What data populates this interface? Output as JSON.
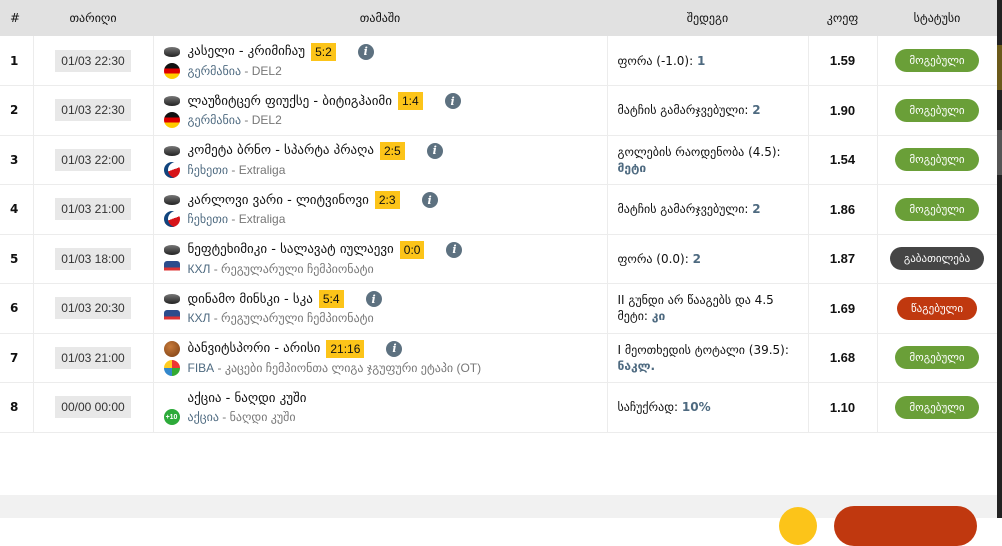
{
  "headers": {
    "num": "#",
    "date": "თარიღი",
    "game": "თამაში",
    "result": "შედეგი",
    "coef": "კოეფ",
    "status": "სტატუსი"
  },
  "rows": [
    {
      "num": "1",
      "date": "01/03 22:30",
      "sport": "hockey",
      "flag": "de",
      "match": "კასელი - კრიმიჩაუ",
      "score": "5:2",
      "country": "გერმანია",
      "league": "DEL2",
      "result_label": "ფორა (-1.0):",
      "result_value": "1",
      "coef": "1.59",
      "status": "მოგებული",
      "status_type": "won"
    },
    {
      "num": "2",
      "date": "01/03 22:30",
      "sport": "hockey",
      "flag": "de",
      "match": "ლაუზიტცერ ფიუქსე - ბიტიგჰაიმი",
      "score": "1:4",
      "country": "გერმანია",
      "league": "DEL2",
      "result_label": "მატჩის გამარჯვებული:",
      "result_value": "2",
      "coef": "1.90",
      "status": "მოგებული",
      "status_type": "won"
    },
    {
      "num": "3",
      "date": "01/03 22:00",
      "sport": "hockey",
      "flag": "cz",
      "match": "კომეტა ბრნო - სპარტა პრაღა",
      "score": "2:5",
      "country": "ჩეხეთი",
      "league": "Extraliga",
      "result_label": "გოლების რაოდენობა (4.5):",
      "result_value": "მეტი",
      "coef": "1.54",
      "status": "მოგებული",
      "status_type": "won"
    },
    {
      "num": "4",
      "date": "01/03 21:00",
      "sport": "hockey",
      "flag": "cz",
      "match": "კარლოვი ვარი - ლიტვინოვი",
      "score": "2:3",
      "country": "ჩეხეთი",
      "league": "Extraliga",
      "result_label": "მატჩის გამარჯვებული:",
      "result_value": "2",
      "coef": "1.86",
      "status": "მოგებული",
      "status_type": "won"
    },
    {
      "num": "5",
      "date": "01/03 18:00",
      "sport": "hockey",
      "flag": "khl",
      "match": "ნეფტეხიმიკი - სალავატ იულაევი",
      "score": "0:0",
      "country": "КХЛ",
      "league": "რეგულარული ჩემპიონატი",
      "result_label": "ფორა (0.0):",
      "result_value": "2",
      "coef": "1.87",
      "status": "გაბათილება",
      "status_type": "push"
    },
    {
      "num": "6",
      "date": "01/03 20:30",
      "sport": "hockey",
      "flag": "khl",
      "match": "დინამო მინსკი - სკა",
      "score": "5:4",
      "country": "КХЛ",
      "league": "რეგულარული ჩემპიონატი",
      "result_label": "II გუნდი არ წააგებს და 4.5 მეტი:",
      "result_value": "კი",
      "coef": "1.69",
      "status": "წაგებული",
      "status_type": "lost"
    },
    {
      "num": "7",
      "date": "01/03 21:00",
      "sport": "basketball",
      "flag": "fiba",
      "match": "ბანვიტსპორი - არისი",
      "score": "21:16",
      "country": "FIBA",
      "league": "კაცები ჩემპიონთა ლიგა ჯგუფური ეტაპი (OT)",
      "result_label": "I მეოთხედის ტოტალი (39.5):",
      "result_value": "ნაკლ.",
      "coef": "1.68",
      "status": "მოგებული",
      "status_type": "won"
    },
    {
      "num": "8",
      "date": "00/00 00:00",
      "sport": "",
      "flag": "plus",
      "flag_text": "+10",
      "match": "აქცია - ნაღდი კუში",
      "score": "",
      "country": "აქცია",
      "league": "ნაღდი კუში",
      "result_label": "საჩუქრად:",
      "result_value": "10%",
      "coef": "1.10",
      "status": "მოგებული",
      "status_type": "won"
    }
  ],
  "colors": {
    "won": "#6a9f38",
    "push": "#454545",
    "lost": "#c0380f",
    "score": "#fcc419"
  }
}
